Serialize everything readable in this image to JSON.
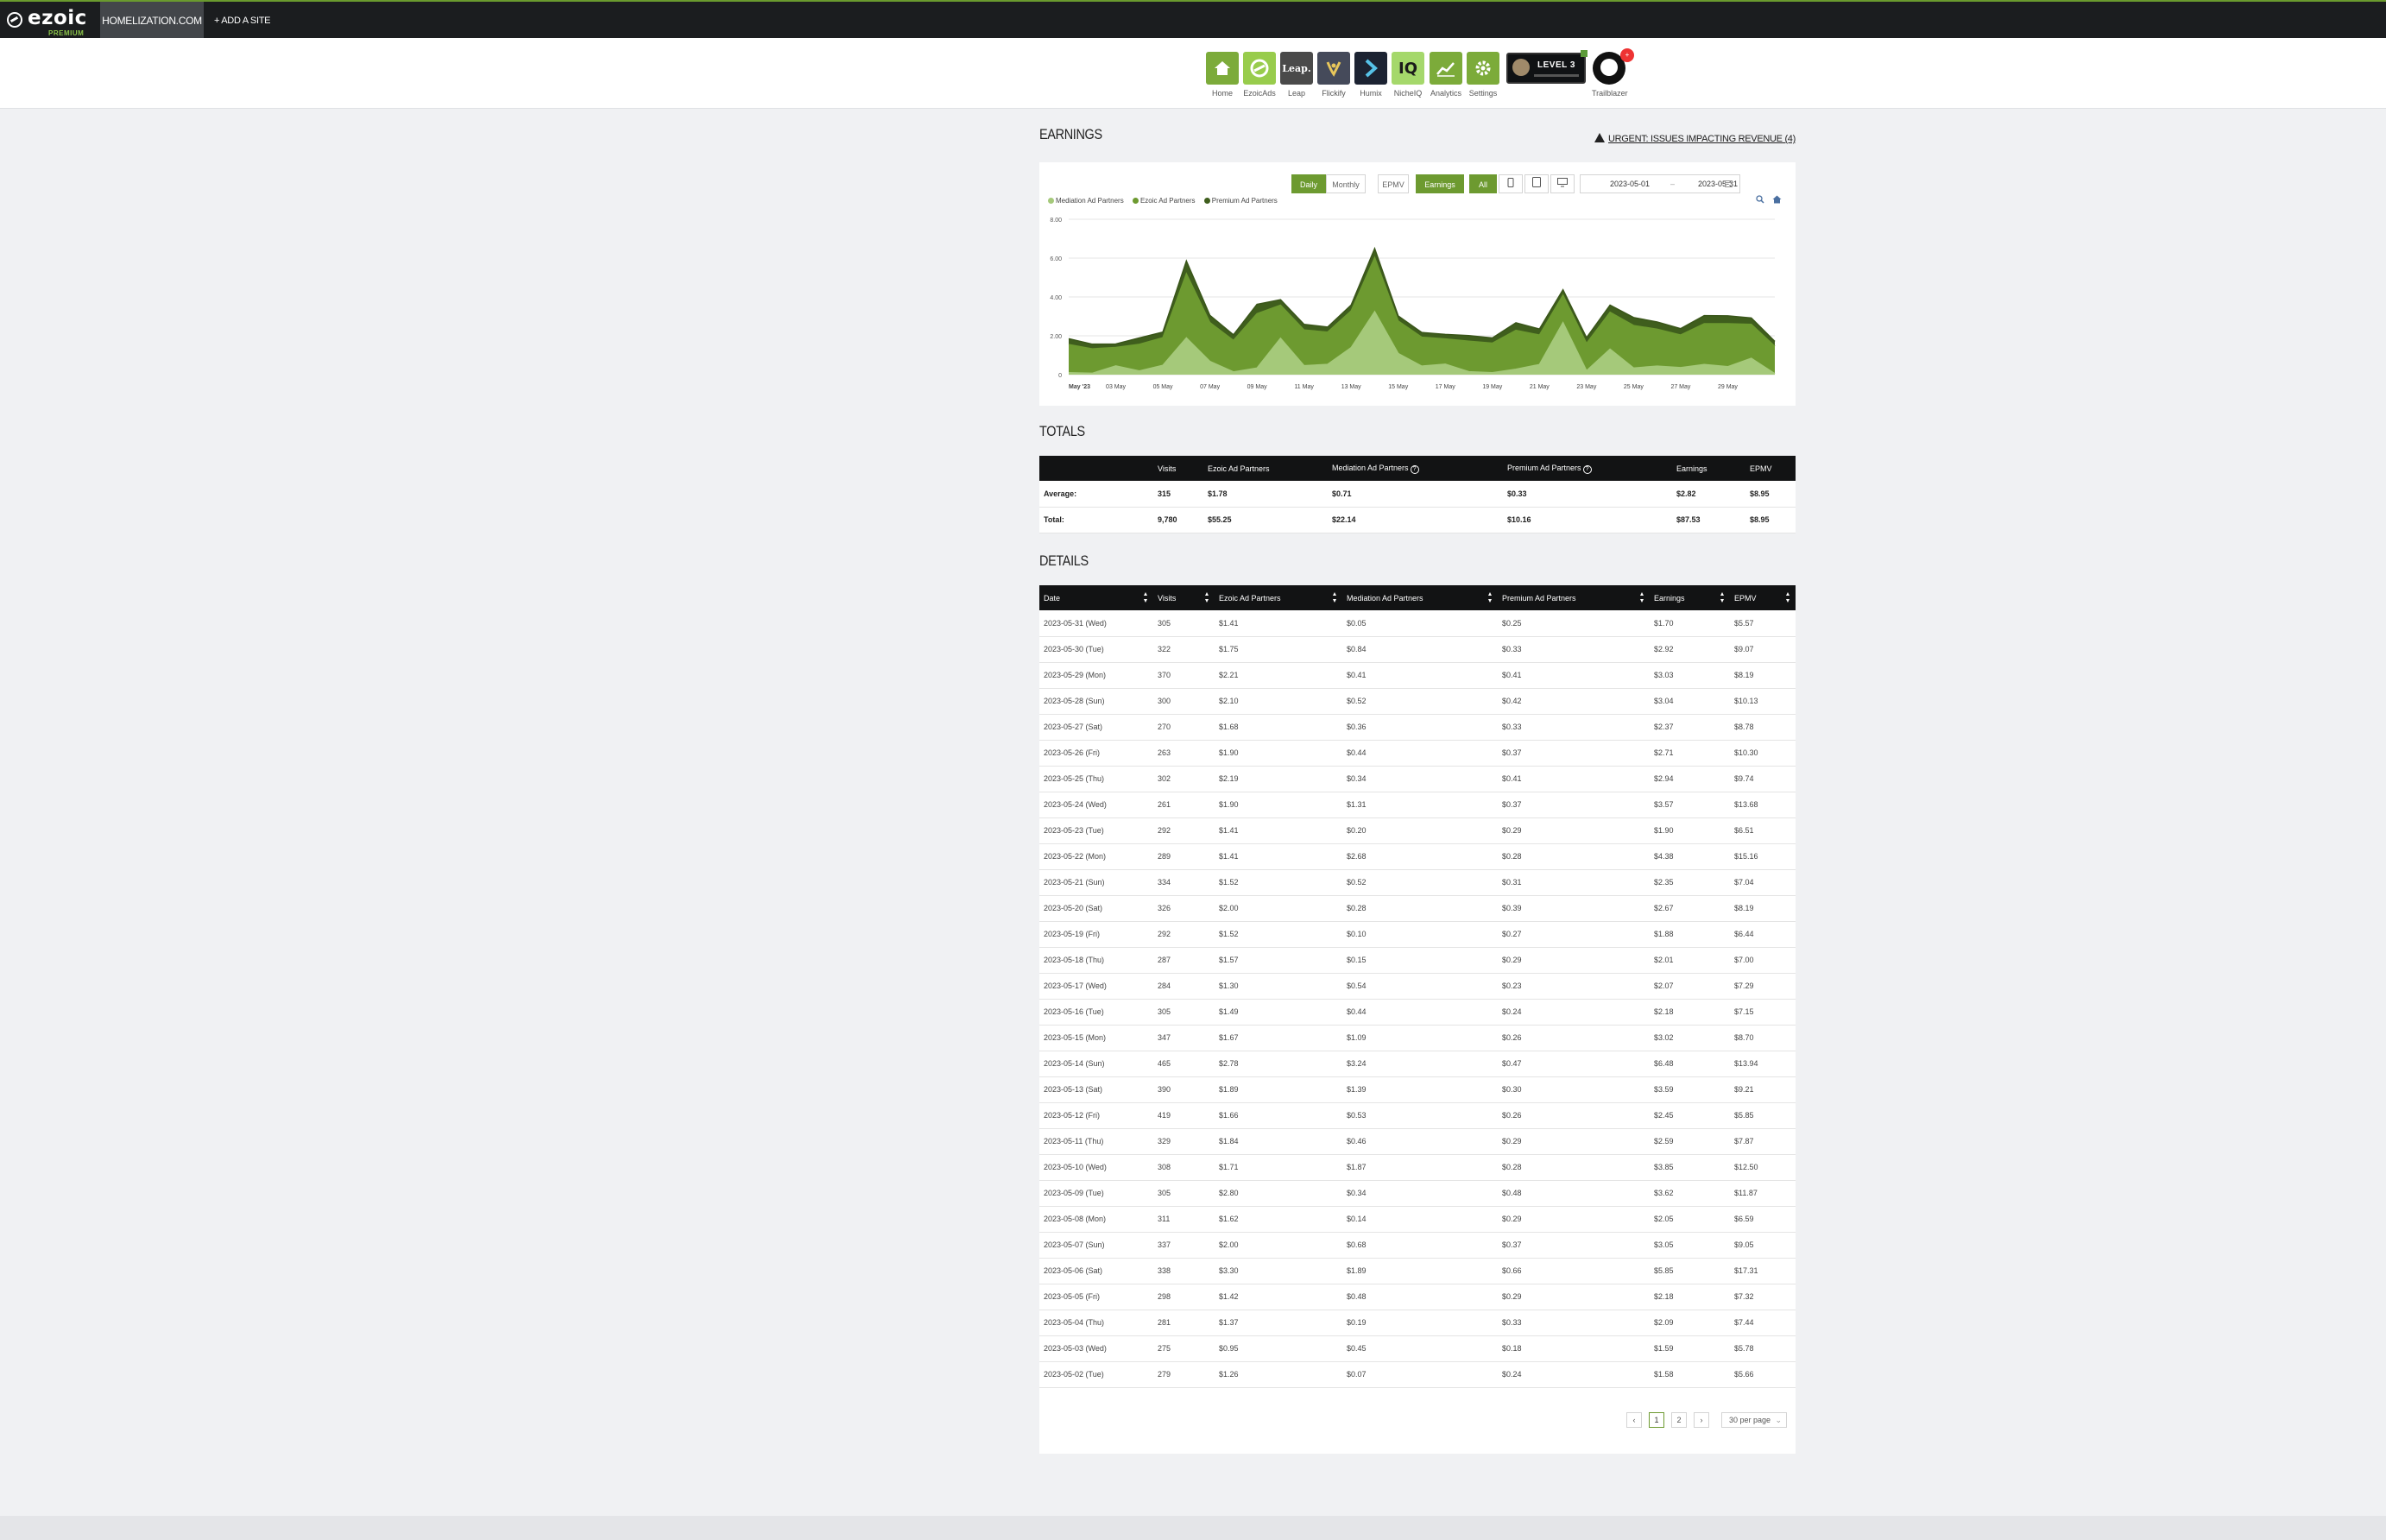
{
  "topbar": {
    "logo_text": "ezoic",
    "logo_sub": "PREMIUM",
    "site_tab": "HOMELIZATION.COM",
    "add_site": "+ ADD A SITE"
  },
  "apps": [
    {
      "label": "Home",
      "icon": "home-icon"
    },
    {
      "label": "EzoicAds",
      "icon": "ezoic-ads-icon"
    },
    {
      "label": "Leap",
      "icon": "leap-icon",
      "text": "Leap."
    },
    {
      "label": "Flickify",
      "icon": "flickify-icon"
    },
    {
      "label": "Humix",
      "icon": "humix-icon"
    },
    {
      "label": "NicheIQ",
      "icon": "nicheiq-icon",
      "text": "IQ"
    },
    {
      "label": "Analytics",
      "icon": "analytics-icon"
    },
    {
      "label": "Settings",
      "icon": "gear-icon"
    }
  ],
  "level_badge": "LEVEL 3",
  "trailblazer": {
    "label": "Trailblazer",
    "badge": "+"
  },
  "earnings": {
    "title": "EARNINGS",
    "urgent": "URGENT: ISSUES IMPACTING REVENUE (4)",
    "controls": {
      "daily": "Daily",
      "monthly": "Monthly",
      "epmv": "EPMV",
      "earnings": "Earnings",
      "all": "All"
    },
    "date_from": "2023-05-01",
    "date_sep": "–",
    "date_to": "2023-05-31",
    "legend": [
      "Mediation Ad Partners",
      "Ezoic Ad Partners",
      "Premium Ad Partners"
    ]
  },
  "chart_data": {
    "type": "area",
    "stacked": true,
    "x": [
      "May '23",
      "02 May",
      "03 May",
      "04 May",
      "05 May",
      "06 May",
      "07 May",
      "08 May",
      "09 May",
      "10 May",
      "11 May",
      "12 May",
      "13 May",
      "14 May",
      "15 May",
      "16 May",
      "17 May",
      "18 May",
      "19 May",
      "20 May",
      "21 May",
      "22 May",
      "23 May",
      "24 May",
      "25 May",
      "26 May",
      "27 May",
      "28 May",
      "29 May",
      "30 May",
      "31 May"
    ],
    "x_tick_labels": [
      "May '23",
      "03 May",
      "05 May",
      "07 May",
      "09 May",
      "11 May",
      "13 May",
      "15 May",
      "17 May",
      "19 May",
      "21 May",
      "23 May",
      "25 May",
      "27 May",
      "29 May"
    ],
    "ylim": [
      0,
      8
    ],
    "y_ticks": [
      "0",
      "2.00",
      "4.00",
      "6.00",
      "8.00"
    ],
    "series": [
      {
        "name": "Mediation Ad Partners",
        "color": "#a5c97a",
        "values": [
          0.1,
          0.07,
          0.45,
          0.19,
          0.48,
          1.89,
          0.68,
          0.14,
          0.34,
          1.87,
          0.46,
          0.53,
          1.39,
          3.24,
          1.09,
          0.44,
          0.54,
          0.15,
          0.1,
          0.28,
          0.52,
          2.68,
          0.2,
          1.31,
          0.34,
          0.44,
          0.36,
          0.52,
          0.41,
          0.84,
          0.05
        ]
      },
      {
        "name": "Ezoic Ad Partners",
        "color": "#6d9a30",
        "values": [
          1.45,
          1.26,
          0.95,
          1.37,
          1.42,
          3.3,
          2.0,
          1.62,
          2.8,
          1.71,
          1.84,
          1.66,
          1.89,
          2.78,
          1.67,
          1.49,
          1.3,
          1.57,
          1.52,
          2.0,
          1.52,
          1.41,
          1.41,
          1.9,
          2.19,
          1.9,
          1.68,
          2.1,
          2.21,
          1.75,
          1.41
        ]
      },
      {
        "name": "Premium Ad Partners",
        "color": "#3f5e1d",
        "values": [
          0.3,
          0.24,
          0.18,
          0.33,
          0.29,
          0.66,
          0.37,
          0.29,
          0.48,
          0.28,
          0.29,
          0.26,
          0.3,
          0.47,
          0.26,
          0.24,
          0.23,
          0.29,
          0.27,
          0.39,
          0.31,
          0.28,
          0.29,
          0.37,
          0.41,
          0.37,
          0.33,
          0.42,
          0.41,
          0.33,
          0.25
        ]
      }
    ]
  },
  "totals": {
    "title": "TOTALS",
    "headers": [
      "",
      "Visits",
      "Ezoic Ad Partners",
      "Mediation Ad Partners",
      "Premium Ad Partners",
      "Earnings",
      "EPMV"
    ],
    "rows": [
      [
        "Average:",
        "315",
        "$1.78",
        "$0.71",
        "$0.33",
        "$2.82",
        "$8.95"
      ],
      [
        "Total:",
        "9,780",
        "$55.25",
        "$22.14",
        "$10.16",
        "$87.53",
        "$8.95"
      ]
    ]
  },
  "details": {
    "title": "DETAILS",
    "headers": [
      "Date",
      "Visits",
      "Ezoic Ad Partners",
      "Mediation Ad Partners",
      "Premium Ad Partners",
      "Earnings",
      "EPMV"
    ],
    "rows": [
      [
        "2023-05-31 (Wed)",
        "305",
        "$1.41",
        "$0.05",
        "$0.25",
        "$1.70",
        "$5.57"
      ],
      [
        "2023-05-30 (Tue)",
        "322",
        "$1.75",
        "$0.84",
        "$0.33",
        "$2.92",
        "$9.07"
      ],
      [
        "2023-05-29 (Mon)",
        "370",
        "$2.21",
        "$0.41",
        "$0.41",
        "$3.03",
        "$8.19"
      ],
      [
        "2023-05-28 (Sun)",
        "300",
        "$2.10",
        "$0.52",
        "$0.42",
        "$3.04",
        "$10.13"
      ],
      [
        "2023-05-27 (Sat)",
        "270",
        "$1.68",
        "$0.36",
        "$0.33",
        "$2.37",
        "$8.78"
      ],
      [
        "2023-05-26 (Fri)",
        "263",
        "$1.90",
        "$0.44",
        "$0.37",
        "$2.71",
        "$10.30"
      ],
      [
        "2023-05-25 (Thu)",
        "302",
        "$2.19",
        "$0.34",
        "$0.41",
        "$2.94",
        "$9.74"
      ],
      [
        "2023-05-24 (Wed)",
        "261",
        "$1.90",
        "$1.31",
        "$0.37",
        "$3.57",
        "$13.68"
      ],
      [
        "2023-05-23 (Tue)",
        "292",
        "$1.41",
        "$0.20",
        "$0.29",
        "$1.90",
        "$6.51"
      ],
      [
        "2023-05-22 (Mon)",
        "289",
        "$1.41",
        "$2.68",
        "$0.28",
        "$4.38",
        "$15.16"
      ],
      [
        "2023-05-21 (Sun)",
        "334",
        "$1.52",
        "$0.52",
        "$0.31",
        "$2.35",
        "$7.04"
      ],
      [
        "2023-05-20 (Sat)",
        "326",
        "$2.00",
        "$0.28",
        "$0.39",
        "$2.67",
        "$8.19"
      ],
      [
        "2023-05-19 (Fri)",
        "292",
        "$1.52",
        "$0.10",
        "$0.27",
        "$1.88",
        "$6.44"
      ],
      [
        "2023-05-18 (Thu)",
        "287",
        "$1.57",
        "$0.15",
        "$0.29",
        "$2.01",
        "$7.00"
      ],
      [
        "2023-05-17 (Wed)",
        "284",
        "$1.30",
        "$0.54",
        "$0.23",
        "$2.07",
        "$7.29"
      ],
      [
        "2023-05-16 (Tue)",
        "305",
        "$1.49",
        "$0.44",
        "$0.24",
        "$2.18",
        "$7.15"
      ],
      [
        "2023-05-15 (Mon)",
        "347",
        "$1.67",
        "$1.09",
        "$0.26",
        "$3.02",
        "$8.70"
      ],
      [
        "2023-05-14 (Sun)",
        "465",
        "$2.78",
        "$3.24",
        "$0.47",
        "$6.48",
        "$13.94"
      ],
      [
        "2023-05-13 (Sat)",
        "390",
        "$1.89",
        "$1.39",
        "$0.30",
        "$3.59",
        "$9.21"
      ],
      [
        "2023-05-12 (Fri)",
        "419",
        "$1.66",
        "$0.53",
        "$0.26",
        "$2.45",
        "$5.85"
      ],
      [
        "2023-05-11 (Thu)",
        "329",
        "$1.84",
        "$0.46",
        "$0.29",
        "$2.59",
        "$7.87"
      ],
      [
        "2023-05-10 (Wed)",
        "308",
        "$1.71",
        "$1.87",
        "$0.28",
        "$3.85",
        "$12.50"
      ],
      [
        "2023-05-09 (Tue)",
        "305",
        "$2.80",
        "$0.34",
        "$0.48",
        "$3.62",
        "$11.87"
      ],
      [
        "2023-05-08 (Mon)",
        "311",
        "$1.62",
        "$0.14",
        "$0.29",
        "$2.05",
        "$6.59"
      ],
      [
        "2023-05-07 (Sun)",
        "337",
        "$2.00",
        "$0.68",
        "$0.37",
        "$3.05",
        "$9.05"
      ],
      [
        "2023-05-06 (Sat)",
        "338",
        "$3.30",
        "$1.89",
        "$0.66",
        "$5.85",
        "$17.31"
      ],
      [
        "2023-05-05 (Fri)",
        "298",
        "$1.42",
        "$0.48",
        "$0.29",
        "$2.18",
        "$7.32"
      ],
      [
        "2023-05-04 (Thu)",
        "281",
        "$1.37",
        "$0.19",
        "$0.33",
        "$2.09",
        "$7.44"
      ],
      [
        "2023-05-03 (Wed)",
        "275",
        "$0.95",
        "$0.45",
        "$0.18",
        "$1.59",
        "$5.78"
      ],
      [
        "2023-05-02 (Tue)",
        "279",
        "$1.26",
        "$0.07",
        "$0.24",
        "$1.58",
        "$5.66"
      ]
    ]
  },
  "pagination": {
    "prev": "‹",
    "pages": [
      "1",
      "2"
    ],
    "current": "1",
    "next": "›",
    "per_page": "30 per page"
  }
}
